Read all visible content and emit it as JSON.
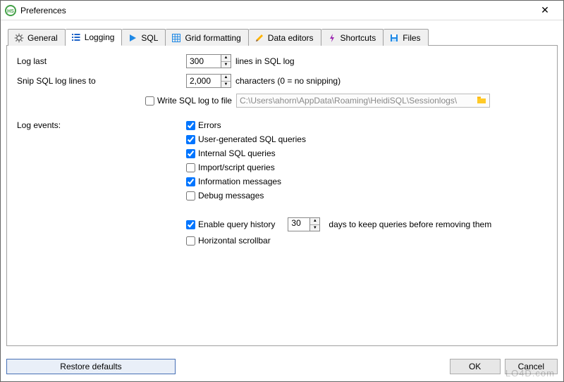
{
  "window": {
    "title": "Preferences"
  },
  "tabs": {
    "general": "General",
    "logging": "Logging",
    "sql": "SQL",
    "grid": "Grid formatting",
    "data": "Data editors",
    "shortcuts": "Shortcuts",
    "files": "Files"
  },
  "logging": {
    "log_last_label": "Log last",
    "log_last_value": "300",
    "log_last_unit": "lines in SQL log",
    "snip_label": "Snip SQL log lines to",
    "snip_value": "2,000",
    "snip_unit": "characters  (0 = no snipping)",
    "write_log_label": "Write SQL log to file",
    "write_log_checked": false,
    "log_file_path": "C:\\Users\\ahorn\\AppData\\Roaming\\HeidiSQL\\Sessionlogs\\",
    "events_label": "Log events:",
    "events": [
      {
        "key": "errors",
        "label": "Errors",
        "checked": true
      },
      {
        "key": "user_sql",
        "label": "User-generated SQL queries",
        "checked": true
      },
      {
        "key": "internal_sql",
        "label": "Internal SQL queries",
        "checked": true
      },
      {
        "key": "import",
        "label": "Import/script queries",
        "checked": false
      },
      {
        "key": "info",
        "label": "Information messages",
        "checked": true
      },
      {
        "key": "debug",
        "label": "Debug messages",
        "checked": false
      }
    ],
    "history_label": "Enable query history",
    "history_checked": true,
    "history_days": "30",
    "history_unit": "days to keep queries before removing them",
    "hscroll_label": "Horizontal scrollbar",
    "hscroll_checked": false
  },
  "buttons": {
    "restore": "Restore defaults",
    "ok": "OK",
    "cancel": "Cancel"
  },
  "watermark": "LO4D.com"
}
